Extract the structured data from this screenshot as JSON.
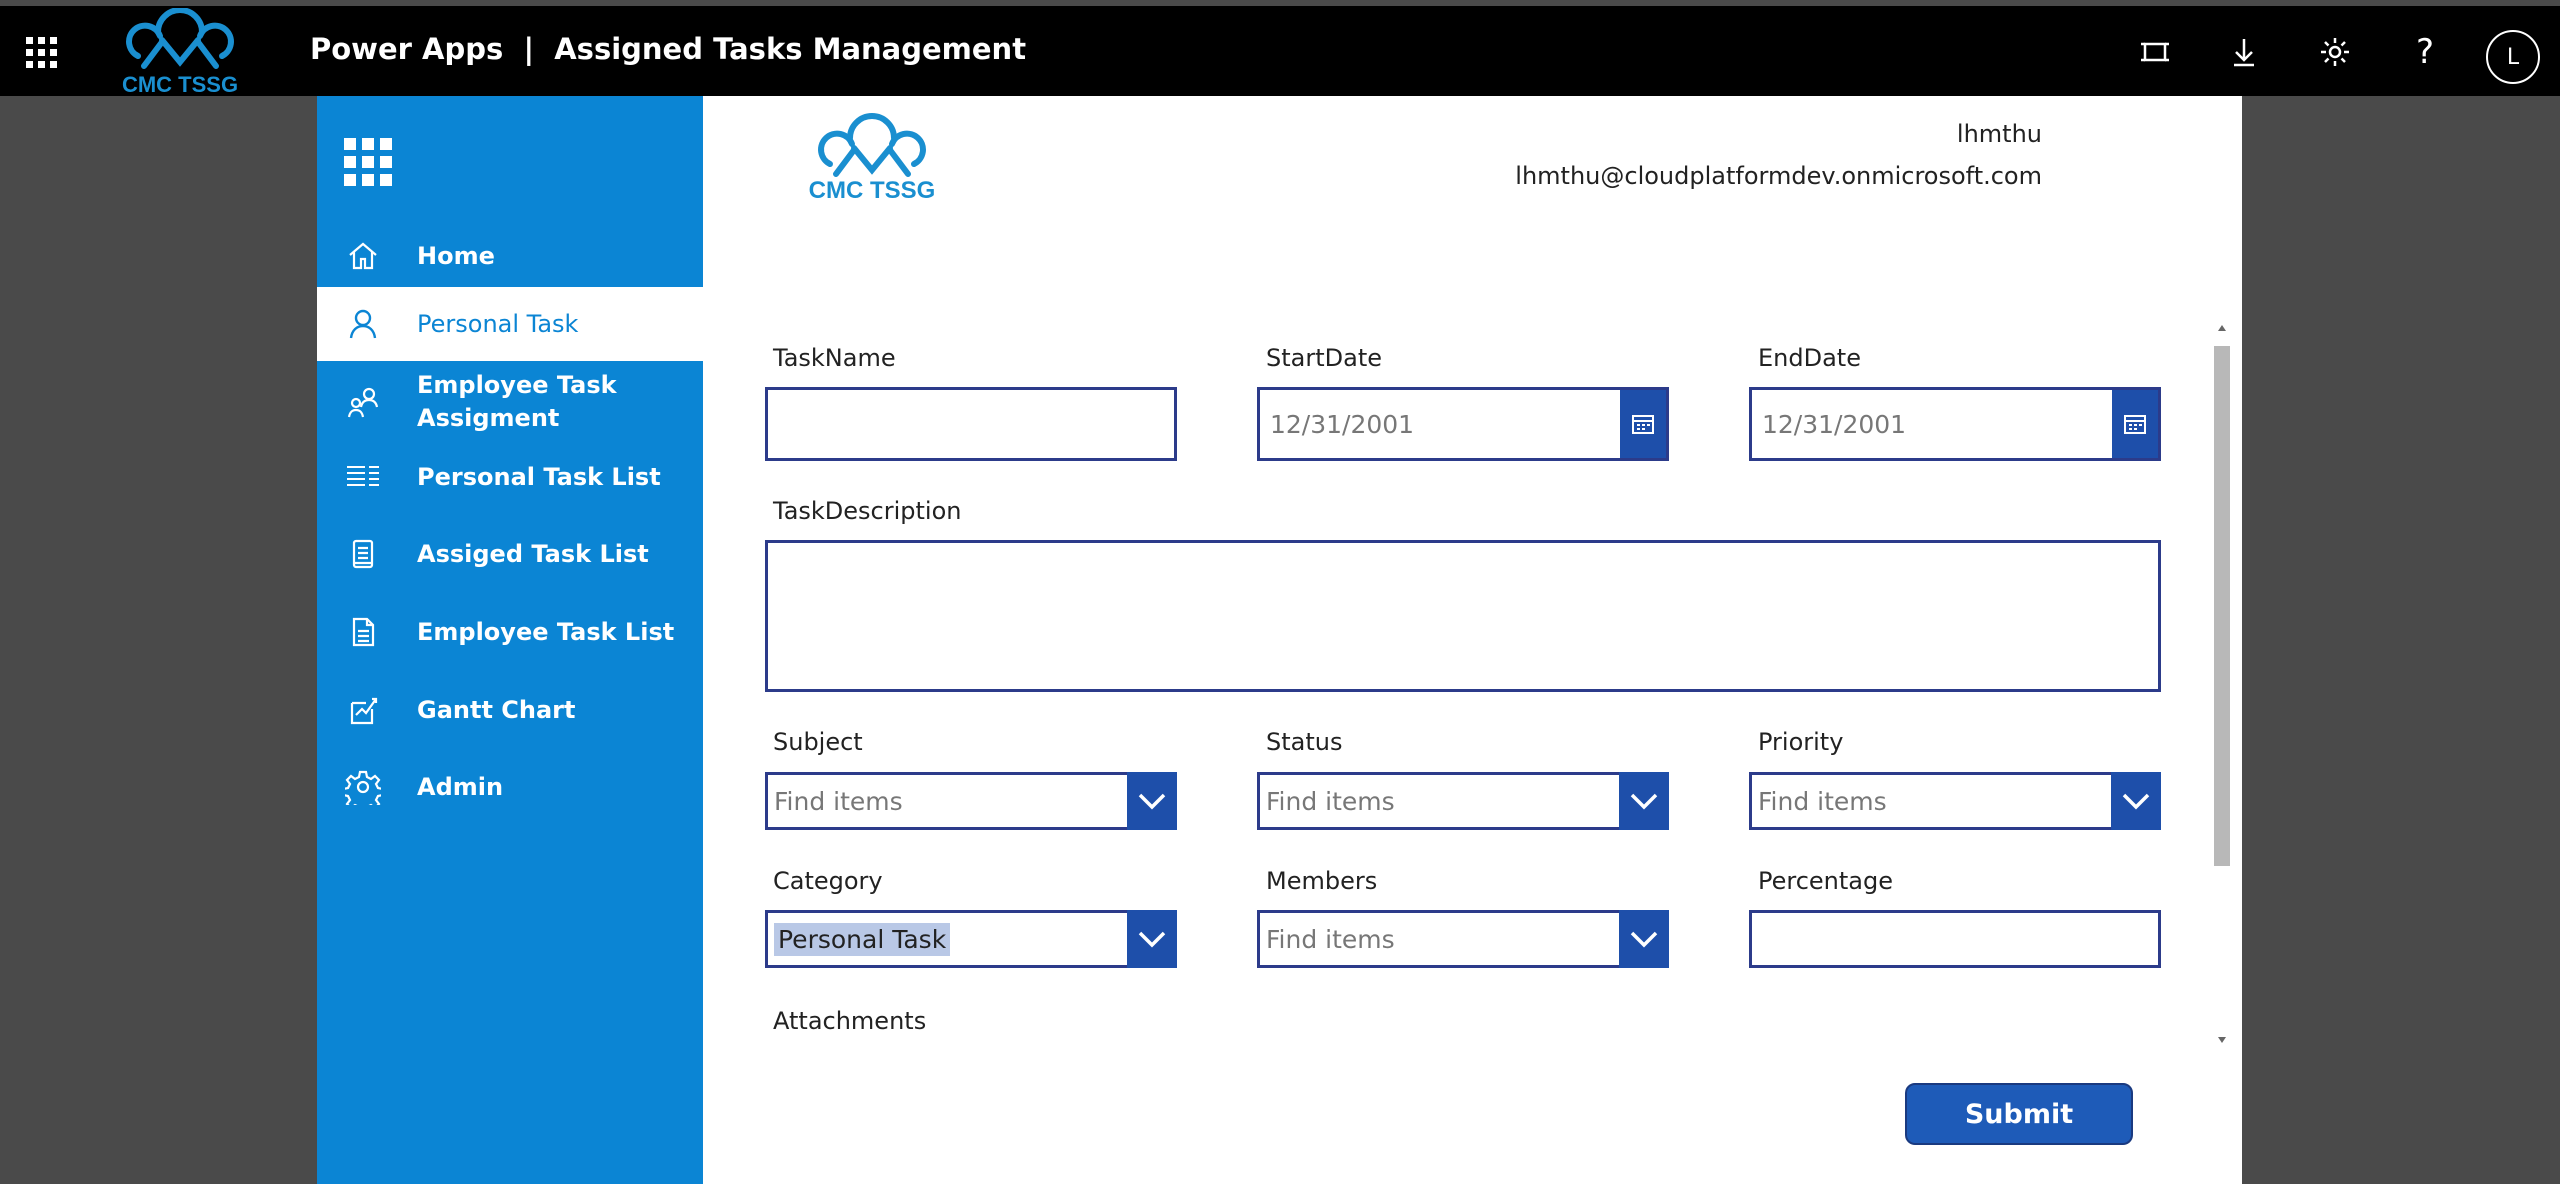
{
  "topbar": {
    "logo_text": "CMC TSSG",
    "app_title": "Power Apps  |  Assigned Tasks Management",
    "icons": [
      "fullscreen-icon",
      "download-icon",
      "settings-icon",
      "help-icon"
    ],
    "help_glyph": "?",
    "avatar_initial": "L"
  },
  "sidebar": {
    "items": [
      {
        "label": "Home",
        "icon": "home-icon"
      },
      {
        "label": "Personal Task",
        "icon": "person-icon",
        "active": true
      },
      {
        "label": "Employee Task\nAssigment",
        "icon": "people-icon"
      },
      {
        "label": "Personal Task List",
        "icon": "list-icon"
      },
      {
        "label": "Assiged Task List",
        "icon": "clipboard-icon"
      },
      {
        "label": "Employee Task List",
        "icon": "document-icon"
      },
      {
        "label": "Gantt Chart",
        "icon": "chart-icon"
      },
      {
        "label": "Admin",
        "icon": "gear-icon"
      }
    ]
  },
  "header": {
    "logo_text": "CMC TSSG",
    "user_name": "lhmthu",
    "user_email": "lhmthu@cloudplatformdev.onmicrosoft.com"
  },
  "form": {
    "task_name": {
      "label": "TaskName",
      "value": ""
    },
    "start_date": {
      "label": "StartDate",
      "value": "12/31/2001"
    },
    "end_date": {
      "label": "EndDate",
      "value": "12/31/2001"
    },
    "task_description": {
      "label": "TaskDescription",
      "value": ""
    },
    "subject": {
      "label": "Subject",
      "placeholder": "Find items"
    },
    "status": {
      "label": "Status",
      "placeholder": "Find items"
    },
    "priority": {
      "label": "Priority",
      "placeholder": "Find items"
    },
    "category": {
      "label": "Category",
      "value": "Personal Task"
    },
    "members": {
      "label": "Members",
      "placeholder": "Find items"
    },
    "percentage": {
      "label": "Percentage",
      "value": ""
    },
    "attachments": {
      "label": "Attachments"
    },
    "submit_label": "Submit"
  },
  "colors": {
    "sidebar": "#0b85d4",
    "accent": "#1e4faa",
    "input_border": "#2c3b8a",
    "topbar": "#000000",
    "logo": "#1a8fd0"
  }
}
